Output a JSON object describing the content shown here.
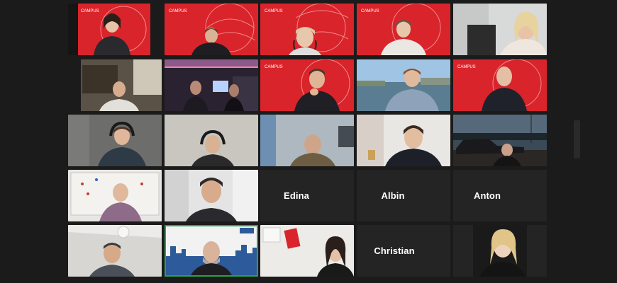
{
  "meeting": {
    "participants": [
      {
        "id": "p1",
        "name": "",
        "video": true,
        "bg": "red-globe"
      },
      {
        "id": "p2",
        "name": "",
        "video": true,
        "bg": "red-globe"
      },
      {
        "id": "p3",
        "name": "",
        "video": true,
        "bg": "red-globe"
      },
      {
        "id": "p4",
        "name": "",
        "video": true,
        "bg": "red-globe"
      },
      {
        "id": "p5",
        "name": "",
        "video": true,
        "bg": "office-light"
      },
      {
        "id": "p6",
        "name": "",
        "video": true,
        "bg": "room-dark"
      },
      {
        "id": "p7",
        "name": "",
        "video": true,
        "bg": "room-neon"
      },
      {
        "id": "p8",
        "name": "",
        "video": true,
        "bg": "red-globe"
      },
      {
        "id": "p9",
        "name": "",
        "video": true,
        "bg": "city-view"
      },
      {
        "id": "p10",
        "name": "",
        "video": true,
        "bg": "red-globe"
      },
      {
        "id": "p11",
        "name": "",
        "video": true,
        "bg": "room-gray"
      },
      {
        "id": "p12",
        "name": "",
        "video": true,
        "bg": "office-gray"
      },
      {
        "id": "p13",
        "name": "",
        "video": true,
        "bg": "office-blue"
      },
      {
        "id": "p14",
        "name": "",
        "video": true,
        "bg": "room-light"
      },
      {
        "id": "p15",
        "name": "",
        "video": true,
        "bg": "night-car"
      },
      {
        "id": "p16",
        "name": "",
        "video": true,
        "bg": "whiteboard"
      },
      {
        "id": "p17",
        "name": "",
        "video": true,
        "bg": "window-light"
      },
      {
        "id": "p18",
        "name": "Edina",
        "video": false
      },
      {
        "id": "p19",
        "name": "Albin",
        "video": false
      },
      {
        "id": "p20",
        "name": "Anton",
        "video": false
      },
      {
        "id": "p21",
        "name": "",
        "video": true,
        "bg": "ceiling-room"
      },
      {
        "id": "p22",
        "name": "",
        "video": true,
        "bg": "city-skyline",
        "active": true
      },
      {
        "id": "p23",
        "name": "",
        "video": true,
        "bg": "office-poster"
      },
      {
        "id": "p24",
        "name": "Christian",
        "video": false
      },
      {
        "id": "p25",
        "name": "",
        "video": true,
        "bg": "dark-portrait"
      }
    ]
  },
  "brand": {
    "logo_text": "CAMPUS"
  },
  "colors": {
    "active_speaker": "#27a44a",
    "tile_off": "#242424",
    "stage": "#1b1b1b",
    "brand_red": "#d9242b"
  }
}
